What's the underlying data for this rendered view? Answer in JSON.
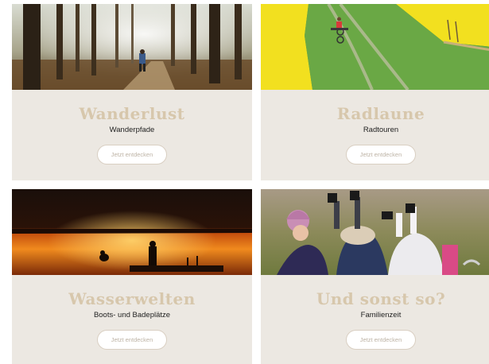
{
  "cards": [
    {
      "title": "Wanderlust",
      "subtitle": "Wanderpfade",
      "button": "Jetzt entdecken",
      "image": "forest-hiker-photo"
    },
    {
      "title": "Radlaune",
      "subtitle": "Radtouren",
      "button": "Jetzt entdecken",
      "image": "field-cyclist-photo"
    },
    {
      "title": "Wasserwelten",
      "subtitle": "Boots- und Badeplätze",
      "button": "Jetzt entdecken",
      "image": "lake-sunset-photo"
    },
    {
      "title": "Und sonst so?",
      "subtitle": "Familienzeit",
      "button": "Jetzt entdecken",
      "image": "children-lying-grass-photo"
    }
  ],
  "colors": {
    "card_bg": "#ece8e2",
    "title": "#d7c7ac",
    "subtitle": "#222222",
    "button_text": "#bdb3a5"
  }
}
